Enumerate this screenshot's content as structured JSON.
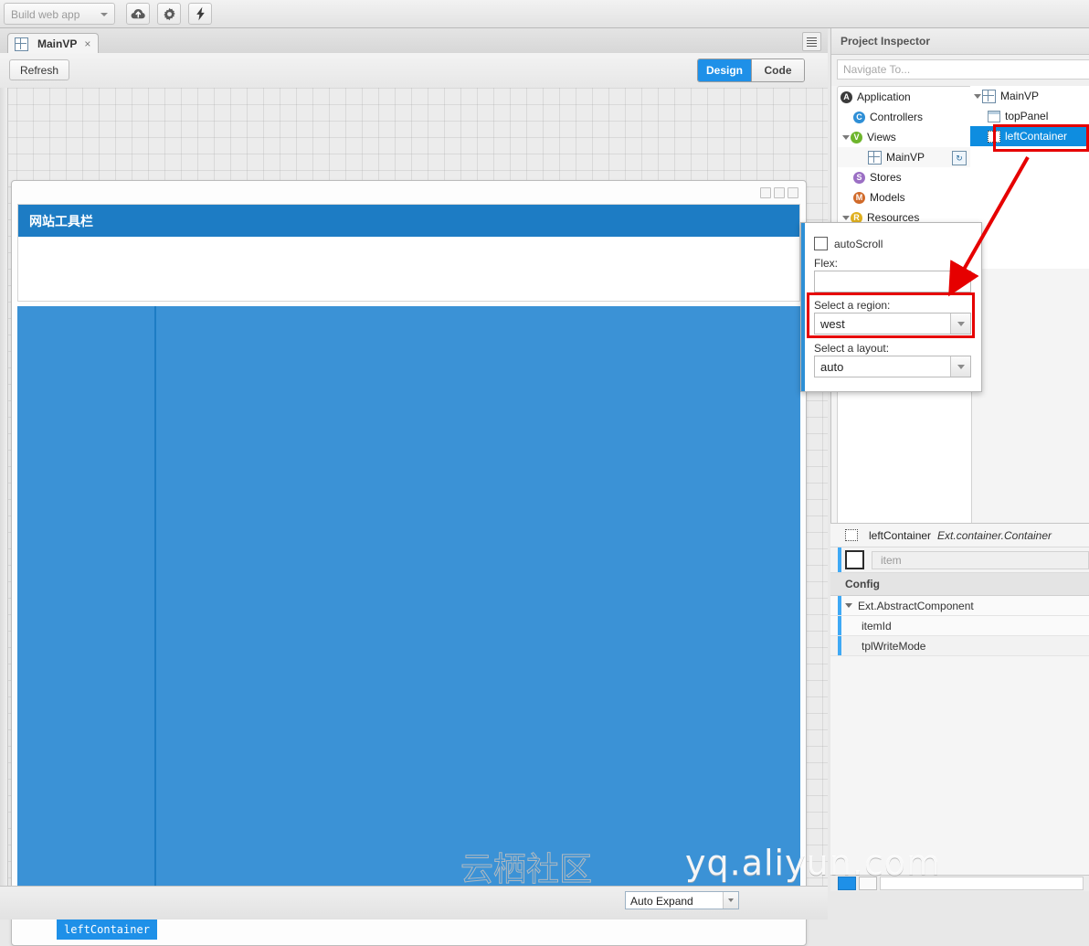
{
  "toolbar": {
    "build_combo_value": "Build web app",
    "buttons": [
      {
        "name": "deploy",
        "icon": "cloud-upload-icon"
      },
      {
        "name": "settings",
        "icon": "gear-icon"
      },
      {
        "name": "run",
        "icon": "lightning-bolt-icon"
      }
    ]
  },
  "editor": {
    "tab": {
      "label": "MainVP",
      "close": "×",
      "icon": "viewport-grid-icon"
    },
    "tab_menu_icon": "list-menu-icon",
    "refresh_label": "Refresh",
    "view_modes": [
      {
        "label": "Design",
        "active": true
      },
      {
        "label": "Code",
        "active": false
      }
    ]
  },
  "canvas": {
    "toppanel_title": "网站工具栏",
    "selection_tag": "leftContainer",
    "blue_header_color": "#1d7cc4",
    "blue_body_color": "#3b92d6",
    "window_controls": [
      "minimize",
      "maximize",
      "close"
    ]
  },
  "bottom": {
    "auto_combo_value": "Auto Expand"
  },
  "inspector": {
    "title": "Project Inspector",
    "navigate_placeholder": "Navigate To...",
    "tree_left": [
      {
        "label": "Application",
        "badge": "A",
        "badge_color": "#3b3b3b",
        "depth": 0,
        "expanded": false
      },
      {
        "label": "Controllers",
        "badge": "C",
        "badge_color": "#2f8fd6",
        "depth": 1,
        "expanded": false
      },
      {
        "label": "Views",
        "badge": "V",
        "badge_color": "#6eb52c",
        "depth": 1,
        "expanded": true
      },
      {
        "label": "MainVP",
        "badge": null,
        "icon": "viewport-grid-icon",
        "depth": 2,
        "refresh": true
      },
      {
        "label": "Stores",
        "badge": "S",
        "badge_color": "#9b6fc4",
        "depth": 1,
        "expanded": false
      },
      {
        "label": "Models",
        "badge": "M",
        "badge_color": "#d06a2a",
        "depth": 1,
        "expanded": false
      },
      {
        "label": "Resources",
        "badge": "R",
        "badge_color": "#e0b01f",
        "depth": 1,
        "expanded": true
      }
    ],
    "tree_right": [
      {
        "label": "MainVP",
        "icon": "viewport-grid-icon",
        "depth": 0,
        "expanded": true,
        "selected": false
      },
      {
        "label": "topPanel",
        "icon": "panel-icon",
        "depth": 1,
        "selected": false
      },
      {
        "label": "leftContainer",
        "icon": "container-icon",
        "depth": 1,
        "selected": true
      }
    ]
  },
  "popup": {
    "autoscroll_label": "autoScroll",
    "autoscroll_checked": false,
    "flex_label": "Flex:",
    "flex_value": "",
    "region_label": "Select a region:",
    "region_value": "west",
    "layout_label": "Select a layout:",
    "layout_value": "auto"
  },
  "config": {
    "component_name": "leftContainer",
    "component_type": "Ext.container.Container",
    "item_placeholder": "item",
    "section_label": "Config",
    "group_label": "Ext.AbstractComponent",
    "rows": [
      "itemId",
      "tplWriteMode"
    ]
  },
  "annotation": {
    "highlight_color": "#e60000",
    "arrow_from": "leftContainer tree node",
    "arrow_to": "Select a region field"
  },
  "watermark": {
    "cn": "云栖社区",
    "en": "yq.aliyun.com"
  }
}
